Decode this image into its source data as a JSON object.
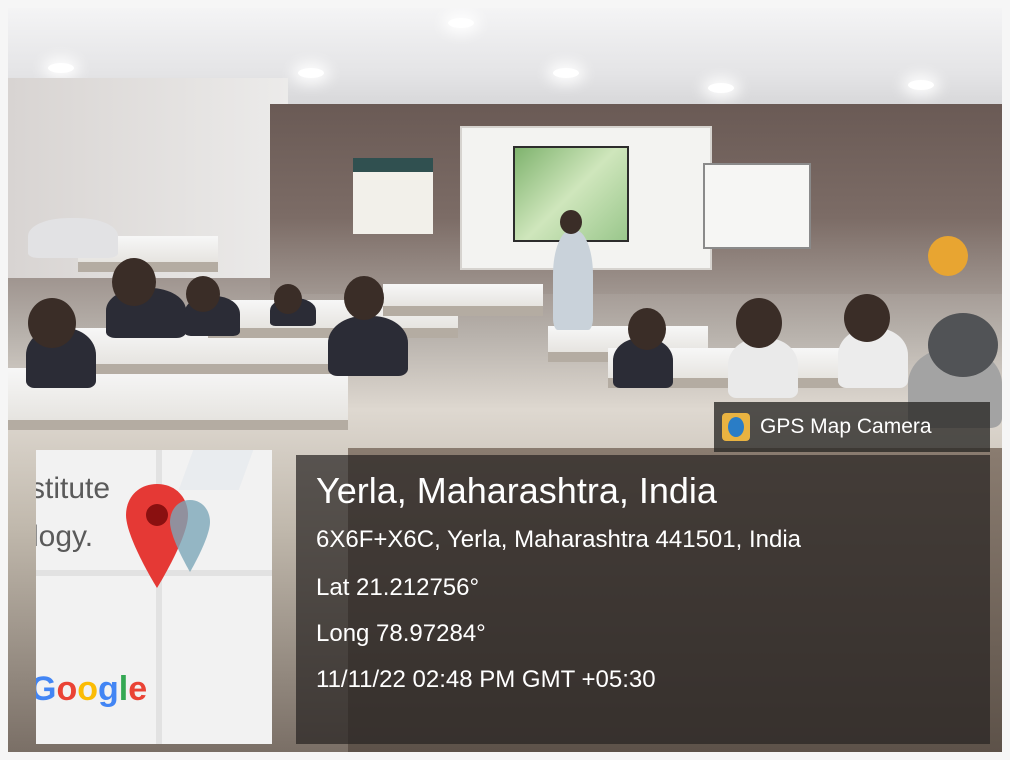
{
  "image": {
    "subject": "classroom lecture hall photo with GPS stamp"
  },
  "gps_badge": {
    "label": "GPS Map Camera",
    "icon": "gps-map-camera-icon"
  },
  "location": {
    "title": "Yerla, Maharashtra, India",
    "address": "6X6F+X6C, Yerla, Maharashtra 441501, India",
    "latitude": "Lat 21.212756°",
    "longitude": "Long 78.97284°",
    "timestamp": "11/11/22 02:48 PM GMT +05:30"
  },
  "map_tile": {
    "text_fragment_1": "stitute",
    "text_fragment_2": "logy.",
    "provider": "Google",
    "pin_icon": "location-pin-icon",
    "colors": {
      "pin": "#e53935",
      "google_blue": "#4285F4",
      "google_red": "#EA4335",
      "google_yellow": "#FBBC05",
      "google_green": "#34A853"
    }
  }
}
